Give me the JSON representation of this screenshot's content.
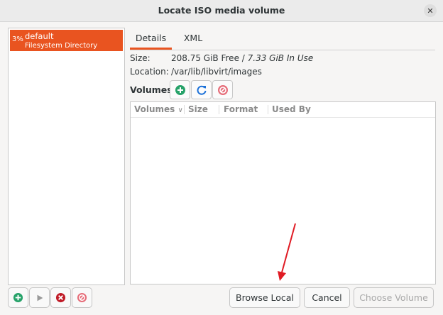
{
  "window": {
    "title": "Locate ISO media volume",
    "close_glyph": "✕"
  },
  "pools": [
    {
      "percent": "3%",
      "name": "default",
      "type": "Filesystem Directory",
      "selected": true
    }
  ],
  "tabs": [
    {
      "label": "Details",
      "active": true
    },
    {
      "label": "XML",
      "active": false
    }
  ],
  "details": {
    "size_label": "Size:",
    "size_free": "208.75 GiB Free /",
    "size_in_use": "7.33 GiB In Use",
    "location_label": "Location:",
    "location_value": "/var/lib/libvirt/images"
  },
  "volumes": {
    "label": "Volumes",
    "toolbar_icons": [
      "add-volume-icon",
      "refresh-icon",
      "delete-volume-icon"
    ],
    "columns": [
      "Volumes",
      "Size",
      "Format",
      "Used By"
    ],
    "sort_indicator": "∨",
    "rows": []
  },
  "pool_toolbar_icons": [
    "add-pool-icon",
    "start-pool-icon",
    "stop-pool-icon",
    "delete-pool-icon"
  ],
  "buttons": {
    "browse_local": "Browse Local",
    "cancel": "Cancel",
    "choose_volume": "Choose Volume"
  },
  "colors": {
    "accent": "#e95420",
    "green": "#26a269",
    "blue": "#1c71d8",
    "red": "#c01c28"
  }
}
